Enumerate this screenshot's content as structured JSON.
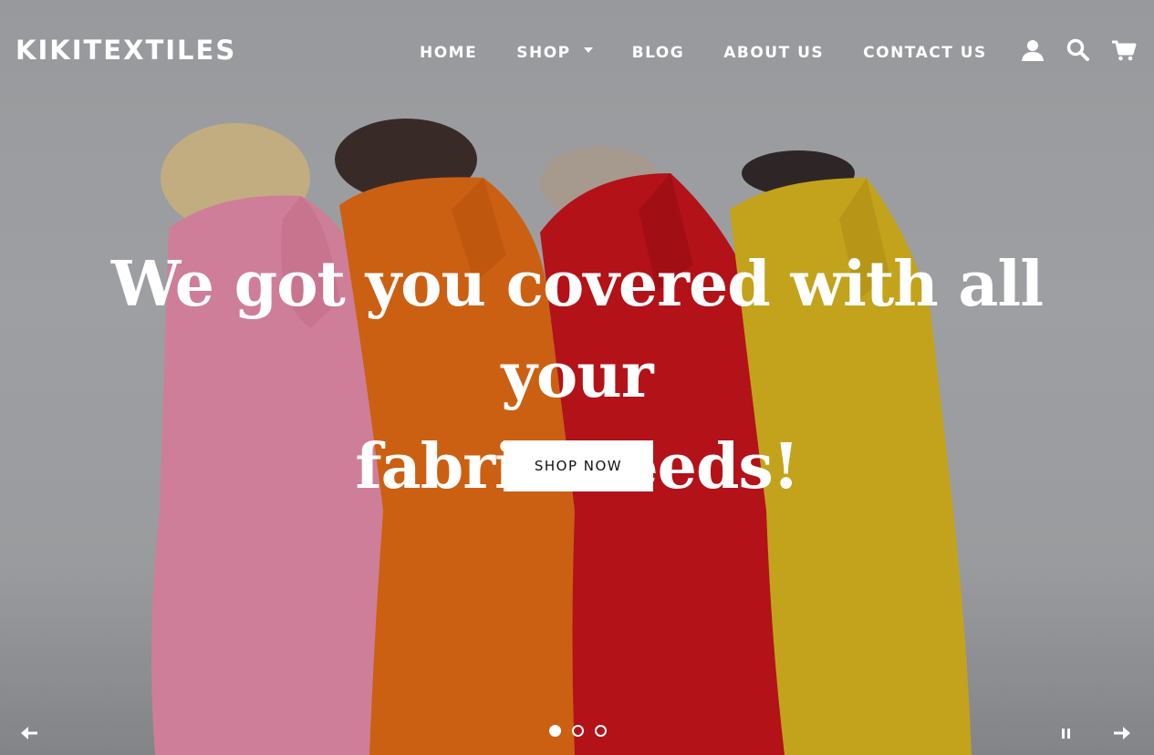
{
  "header": {
    "logo": "KIKITEXTILES",
    "nav": [
      {
        "label": "HOME"
      },
      {
        "label": "SHOP"
      },
      {
        "label": "BLOG"
      },
      {
        "label": "ABOUT US"
      },
      {
        "label": "CONTACT US"
      }
    ],
    "icons": [
      "account-icon",
      "search-icon",
      "cart-icon"
    ]
  },
  "hero": {
    "headline_line1": "We got you covered with all your",
    "headline_line2": "fabric needs!",
    "cta_label": "SHOP NOW",
    "image_colors": {
      "pink": "#e883a6",
      "orange": "#e26a12",
      "red": "#c80f16",
      "yellow": "#d8b21a"
    }
  },
  "slider": {
    "slide_count": 3,
    "active_slide": 1,
    "controls": [
      "prev-arrow-icon",
      "pause-icon",
      "next-arrow-icon"
    ]
  }
}
